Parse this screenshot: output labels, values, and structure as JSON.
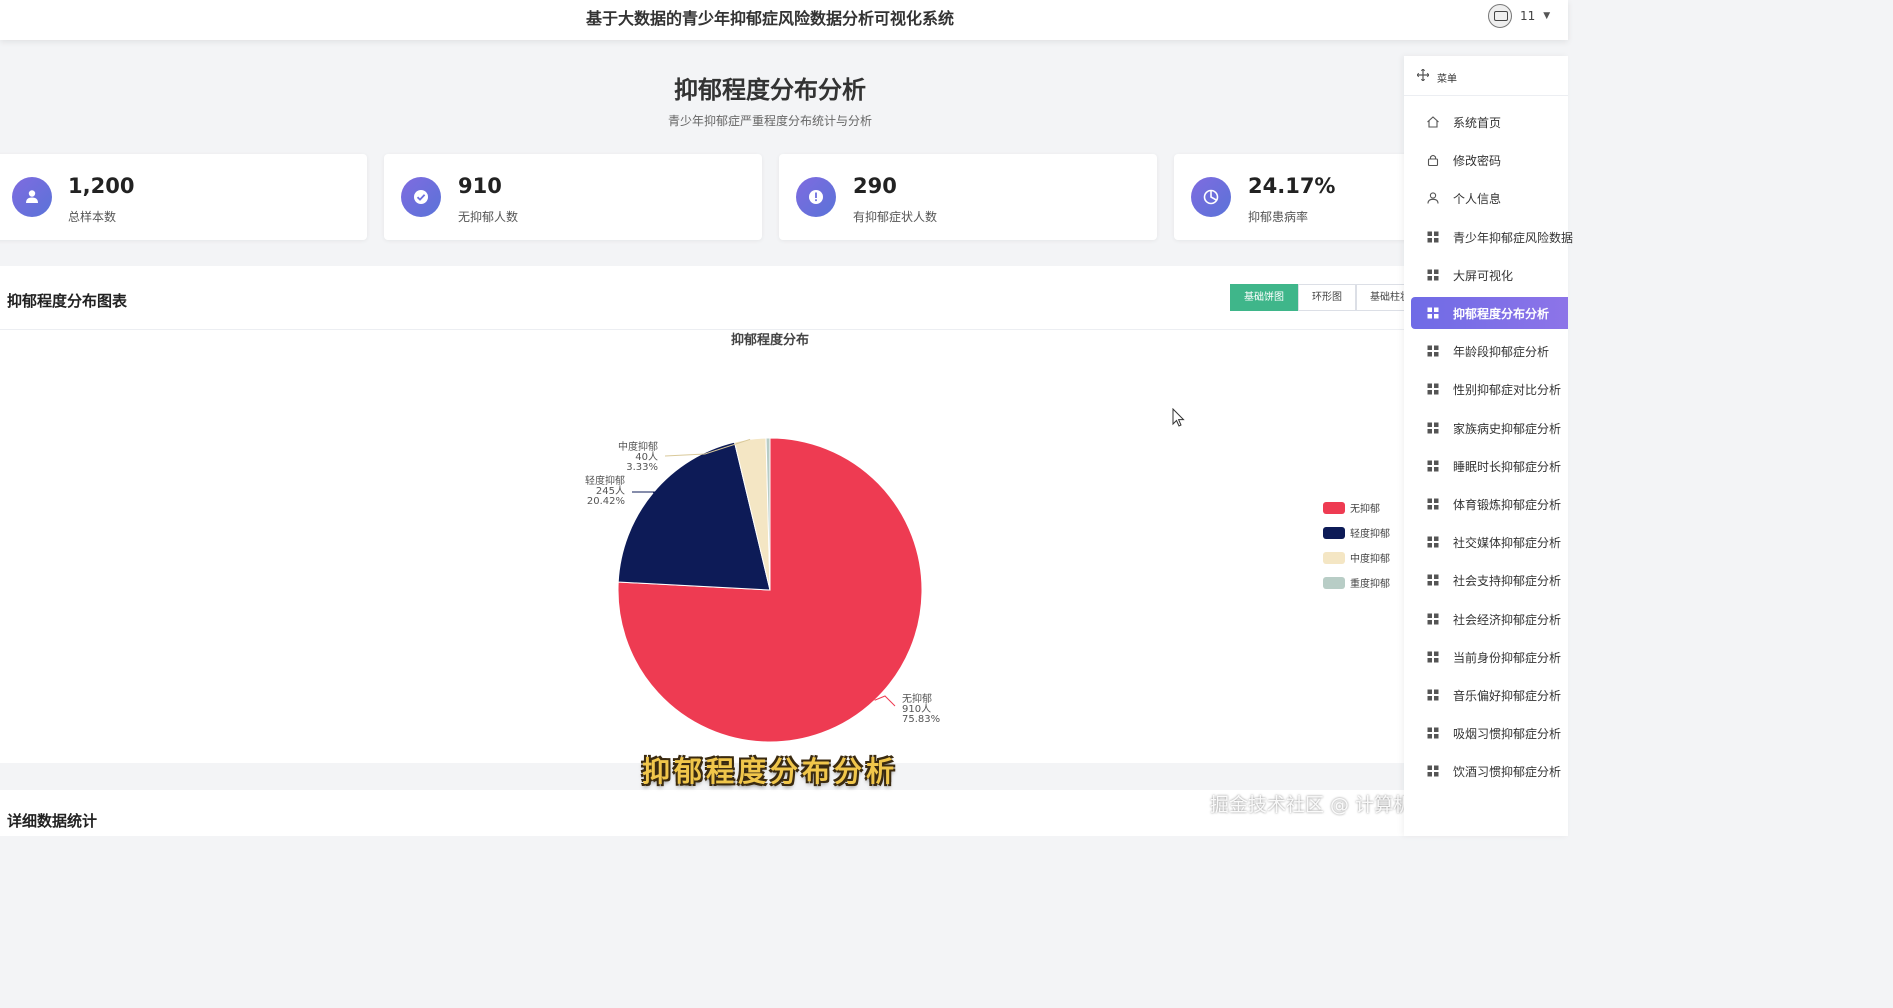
{
  "header": {
    "title": "基于大数据的青少年抑郁症风险数据分析可视化系统",
    "user_name": "11"
  },
  "page": {
    "title": "抑郁程度分布分析",
    "subtitle": "青少年抑郁症严重程度分布统计与分析"
  },
  "stats": [
    {
      "value": "1,200",
      "label": "总样本数",
      "icon": "user-icon"
    },
    {
      "value": "910",
      "label": "无抑郁人数",
      "icon": "check-icon"
    },
    {
      "value": "290",
      "label": "有抑郁症状人数",
      "icon": "alert-icon"
    },
    {
      "value": "24.17%",
      "label": "抑郁患病率",
      "icon": "pie-icon"
    }
  ],
  "chart_panel": {
    "title": "抑郁程度分布图表",
    "buttons": [
      "基础饼图",
      "环形图",
      "基础柱状"
    ],
    "active_button": "基础饼图"
  },
  "chart_data": {
    "type": "pie",
    "title": "抑郁程度分布",
    "legend_position": "right",
    "slices": [
      {
        "name": "无抑郁",
        "value": 910,
        "count_label": "910人",
        "percent_label": "75.83%",
        "color": "#ee3b52"
      },
      {
        "name": "轻度抑郁",
        "value": 245,
        "count_label": "245人",
        "percent_label": "20.42%",
        "color": "#0d1b57"
      },
      {
        "name": "中度抑郁",
        "value": 40,
        "count_label": "40人",
        "percent_label": "3.33%",
        "color": "#f4e6c4"
      },
      {
        "name": "重度抑郁",
        "value": 5,
        "count_label": "",
        "percent_label": "",
        "color": "#b8cdc6"
      }
    ]
  },
  "bottom_panel": {
    "title": "详细数据统计"
  },
  "caption": "抑郁程度分布分析",
  "watermark": "掘金技术社区 @ 计算机毕设指导师",
  "sidebar": {
    "header": "菜单",
    "items": [
      {
        "label": "系统首页",
        "icon": "home-icon"
      },
      {
        "label": "修改密码",
        "icon": "lock-icon"
      },
      {
        "label": "个人信息",
        "icon": "person-icon"
      },
      {
        "label": "青少年抑郁症风险数据",
        "icon": "grid-icon"
      },
      {
        "label": "大屏可视化",
        "icon": "grid-icon"
      },
      {
        "label": "抑郁程度分布分析",
        "icon": "grid-icon",
        "active": true
      },
      {
        "label": "年龄段抑郁症分析",
        "icon": "grid-icon"
      },
      {
        "label": "性别抑郁症对比分析",
        "icon": "grid-icon"
      },
      {
        "label": "家族病史抑郁症分析",
        "icon": "grid-icon"
      },
      {
        "label": "睡眠时长抑郁症分析",
        "icon": "grid-icon"
      },
      {
        "label": "体育锻炼抑郁症分析",
        "icon": "grid-icon"
      },
      {
        "label": "社交媒体抑郁症分析",
        "icon": "grid-icon"
      },
      {
        "label": "社会支持抑郁症分析",
        "icon": "grid-icon"
      },
      {
        "label": "社会经济抑郁症分析",
        "icon": "grid-icon"
      },
      {
        "label": "当前身份抑郁症分析",
        "icon": "grid-icon"
      },
      {
        "label": "音乐偏好抑郁症分析",
        "icon": "grid-icon"
      },
      {
        "label": "吸烟习惯抑郁症分析",
        "icon": "grid-icon"
      },
      {
        "label": "饮酒习惯抑郁症分析",
        "icon": "grid-icon"
      }
    ]
  }
}
